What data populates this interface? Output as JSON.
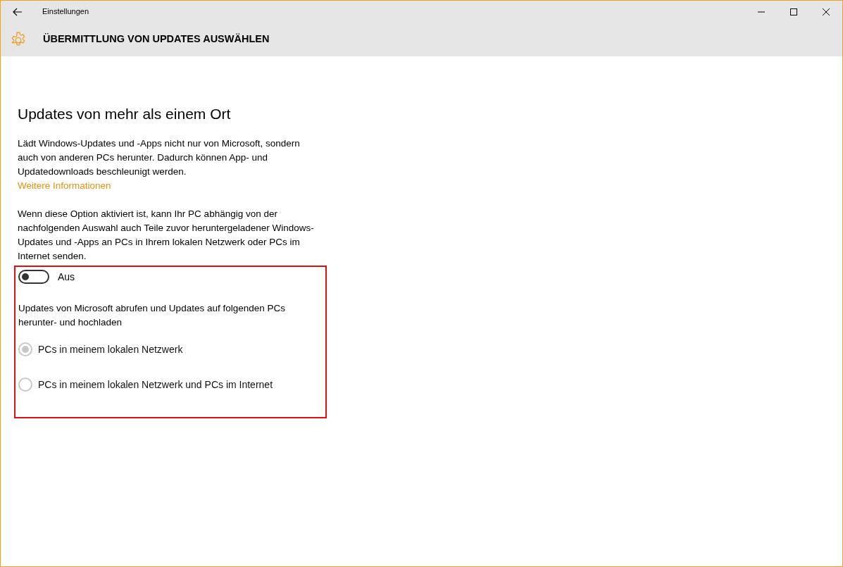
{
  "window": {
    "title": "Einstellungen"
  },
  "header": {
    "title": "ÜBERMITTLUNG VON UPDATES AUSWÄHLEN"
  },
  "section": {
    "heading": "Updates von mehr als einem Ort",
    "description": "Lädt Windows-Updates und -Apps nicht nur von Microsoft, sondern auch von anderen PCs herunter. Dadurch können App- und Updatedownloads beschleunigt werden.",
    "link": "Weitere Informationen",
    "explanation": "Wenn diese Option aktiviert ist, kann Ihr PC abhängig von der nachfolgenden Auswahl auch Teile zuvor heruntergeladener Windows-Updates und -Apps an PCs in Ihrem lokalen Netzwerk oder PCs im Internet senden.",
    "toggle": {
      "on": false,
      "label": "Aus"
    },
    "options_label": "Updates von Microsoft abrufen und Updates auf folgenden PCs herunter- und hochladen",
    "options": [
      {
        "label": "PCs in meinem lokalen Netzwerk",
        "selected": true,
        "disabled": true
      },
      {
        "label": "PCs in meinem lokalen Netzwerk und PCs im Internet",
        "selected": false,
        "disabled": true
      }
    ]
  }
}
